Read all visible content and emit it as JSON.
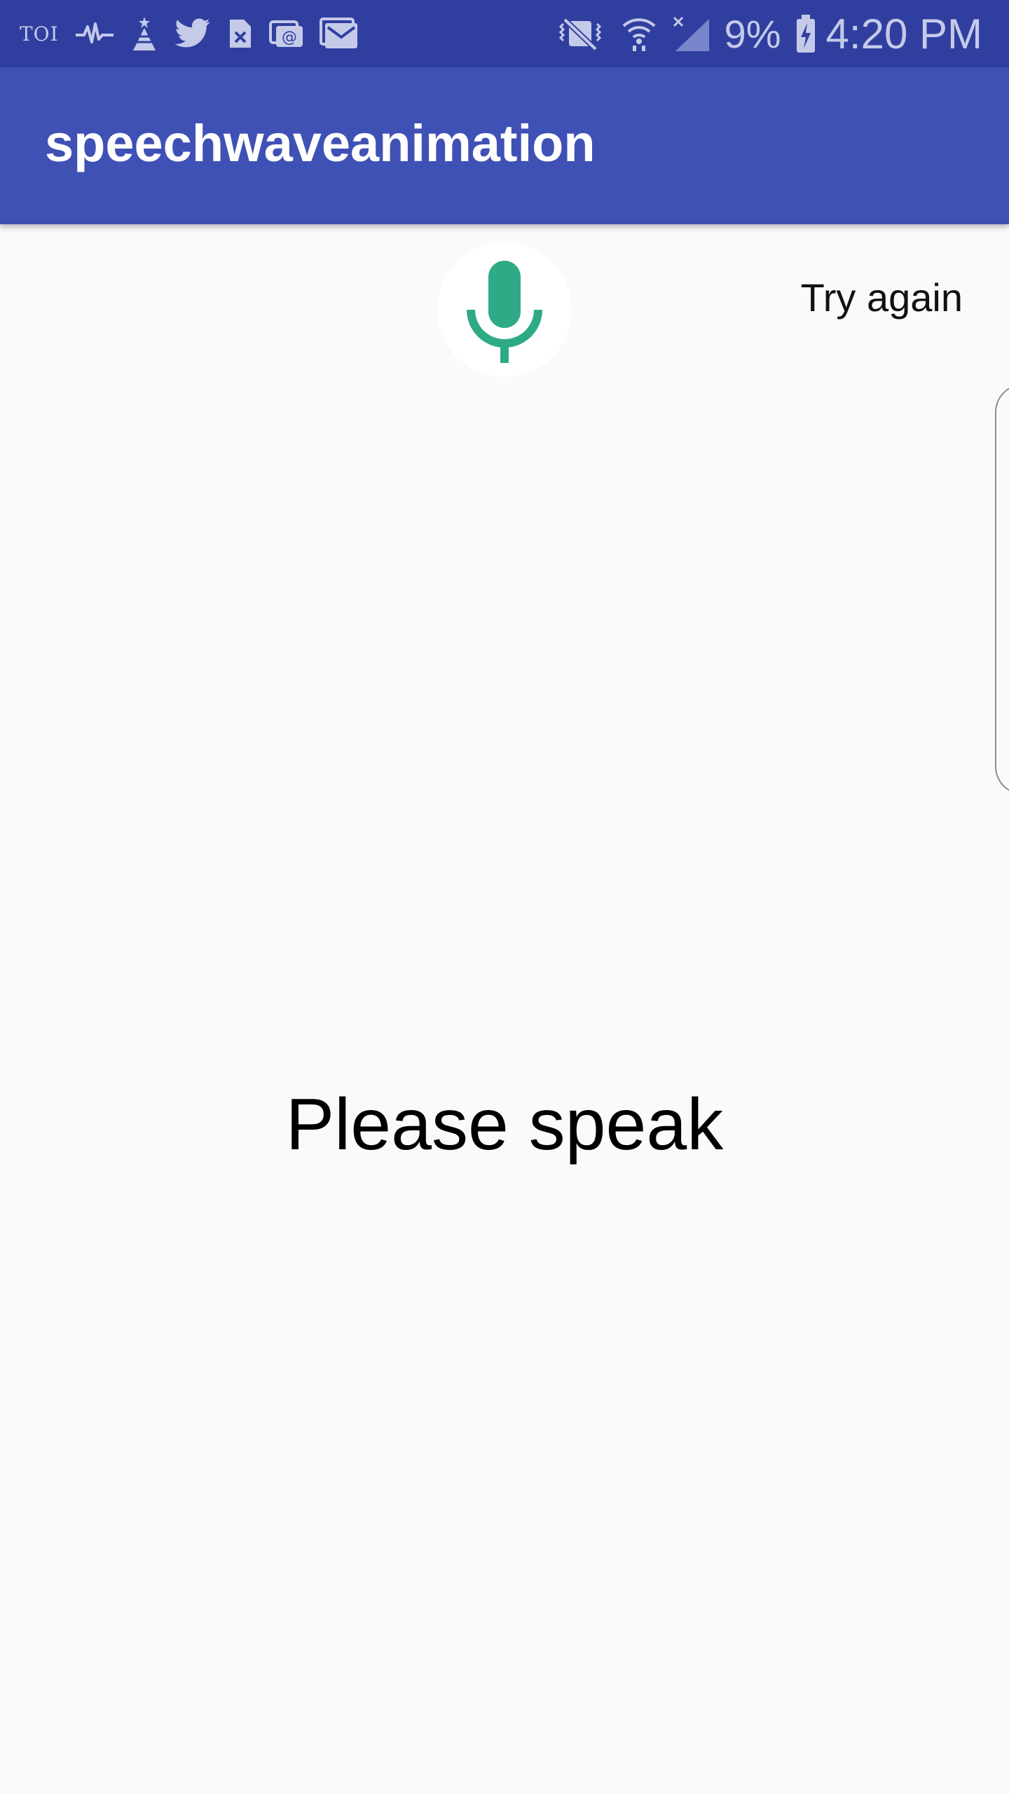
{
  "status_bar": {
    "left_icons": [
      "toi-icon",
      "pulse-icon",
      "tower-icon",
      "twitter-icon",
      "sim-error-icon",
      "email-icon",
      "gmail-icon"
    ],
    "toi_text": "TOI",
    "right_icons": [
      "vibrate-mute-icon",
      "wifi-icon",
      "no-signal-icon",
      "battery-charging-icon"
    ],
    "battery_percent": "9%",
    "time": "4:20 PM",
    "background_color": "#303f9f"
  },
  "app_bar": {
    "title": "speechwaveanimation",
    "background_color": "#3f51b5"
  },
  "content": {
    "mic_icon": "microphone-icon",
    "mic_color": "#2eaa86",
    "try_again_label": "Try again",
    "prompt": "Please speak"
  }
}
